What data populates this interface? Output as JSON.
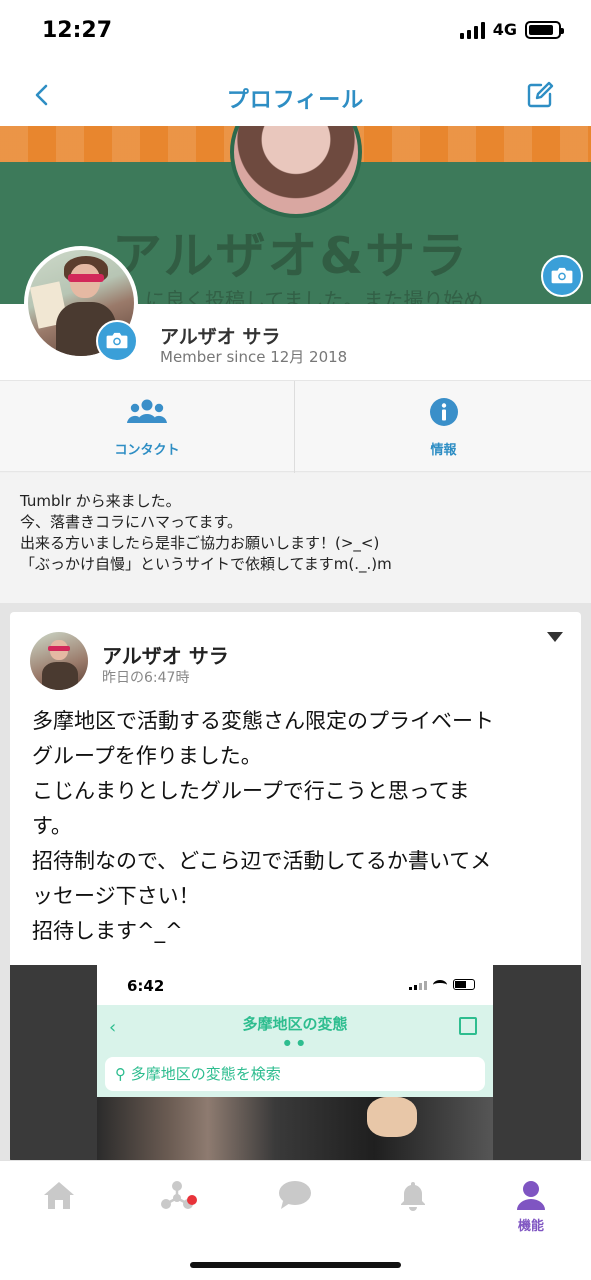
{
  "status_bar": {
    "time": "12:27",
    "network": "4G"
  },
  "nav": {
    "title": "プロフィール"
  },
  "cover": {
    "title_text": "アルザオ&サラ",
    "subtitle_text": "に良く投稿してました。また撮り始め"
  },
  "profile": {
    "name": "アルザオ サラ",
    "member_since": "Member since 12月 2018"
  },
  "actions": {
    "contacts_label": "コンタクト",
    "info_label": "情報"
  },
  "bio": {
    "lines": [
      "Tumblr から来ました。",
      "今、落書きコラにハマってます。",
      "出来る方いましたら是非ご協力お願いします！(>_<)",
      "「ぶっかけ自慢」というサイトで依頼してますm(._.)m"
    ]
  },
  "post": {
    "author": "アルザオ サラ",
    "time": "昨日の6:47時",
    "text_lines": [
      "多摩地区で活動する変態さん限定のプライベート",
      "グループを作りました。",
      "こじんまりとしたグループで行こうと思ってま",
      "す。",
      "招待制なので、どこら辺で活動してるか書いてメ",
      "ッセージ下さい！",
      "招待します^_^"
    ],
    "image": {
      "status_time": "6:42",
      "title": "多摩地区の変態",
      "search_placeholder": "多摩地区の変態を検索"
    }
  },
  "tab_bar": {
    "tabs": [
      {
        "name": "home",
        "icon": "home-icon",
        "label": ""
      },
      {
        "name": "network",
        "icon": "network-icon",
        "label": ""
      },
      {
        "name": "chat",
        "icon": "chat-icon",
        "label": ""
      },
      {
        "name": "notifications",
        "icon": "bell-icon",
        "label": ""
      },
      {
        "name": "features",
        "icon": "user-icon",
        "label": "機能"
      }
    ]
  },
  "colors": {
    "accent": "#2e8ec4",
    "active_tab": "#7f55c2",
    "badge": "#e8333a",
    "cover_green": "#3d7a5a",
    "cover_orange": "#e8862e"
  }
}
